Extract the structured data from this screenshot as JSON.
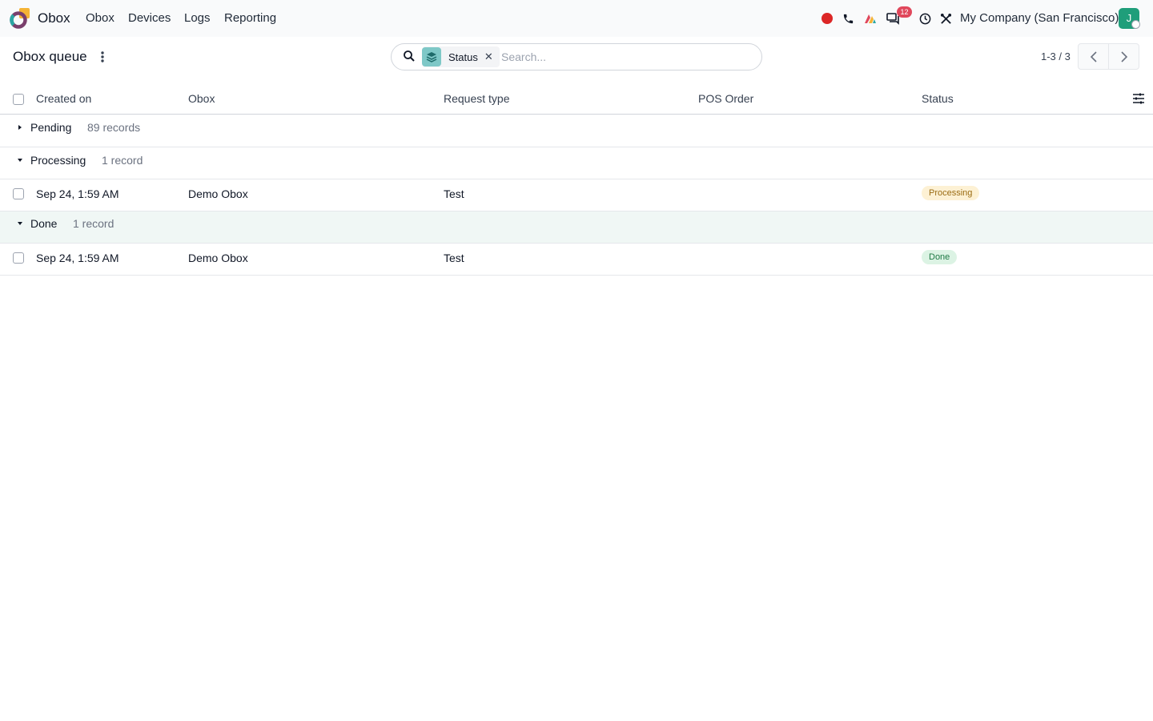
{
  "app": {
    "name": "Obox"
  },
  "menu": [
    "Obox",
    "Devices",
    "Logs",
    "Reporting"
  ],
  "systray": {
    "chat_badge": "12",
    "company": "My Company (San Francisco)",
    "avatar_initial": "J"
  },
  "control_panel": {
    "title": "Obox queue",
    "search": {
      "facet_label": "Status",
      "placeholder": "Search..."
    },
    "pager": "1-3 / 3"
  },
  "columns": [
    "Created on",
    "Obox",
    "Request type",
    "POS Order",
    "Status"
  ],
  "groups": [
    {
      "name": "Pending",
      "count": "89 records",
      "expanded": false,
      "rows": []
    },
    {
      "name": "Processing",
      "count": "1 record",
      "expanded": true,
      "rows": [
        {
          "created_on": "Sep 24, 1:59 AM",
          "obox": "Demo Obox",
          "request_type": "Test",
          "pos_order": "",
          "status": "Processing"
        }
      ]
    },
    {
      "name": "Done",
      "count": "1 record",
      "expanded": true,
      "rows": [
        {
          "created_on": "Sep 24, 1:59 AM",
          "obox": "Demo Obox",
          "request_type": "Test",
          "pos_order": "",
          "status": "Done"
        }
      ]
    }
  ],
  "colors": {
    "processing_bg": "#fdf1d4",
    "processing_fg": "#9a6b12",
    "done_bg": "#dcf3e4",
    "done_fg": "#1f7a45",
    "accent": "#1f9e7a",
    "badge": "#e0475b",
    "record_red": "#dc2626"
  }
}
